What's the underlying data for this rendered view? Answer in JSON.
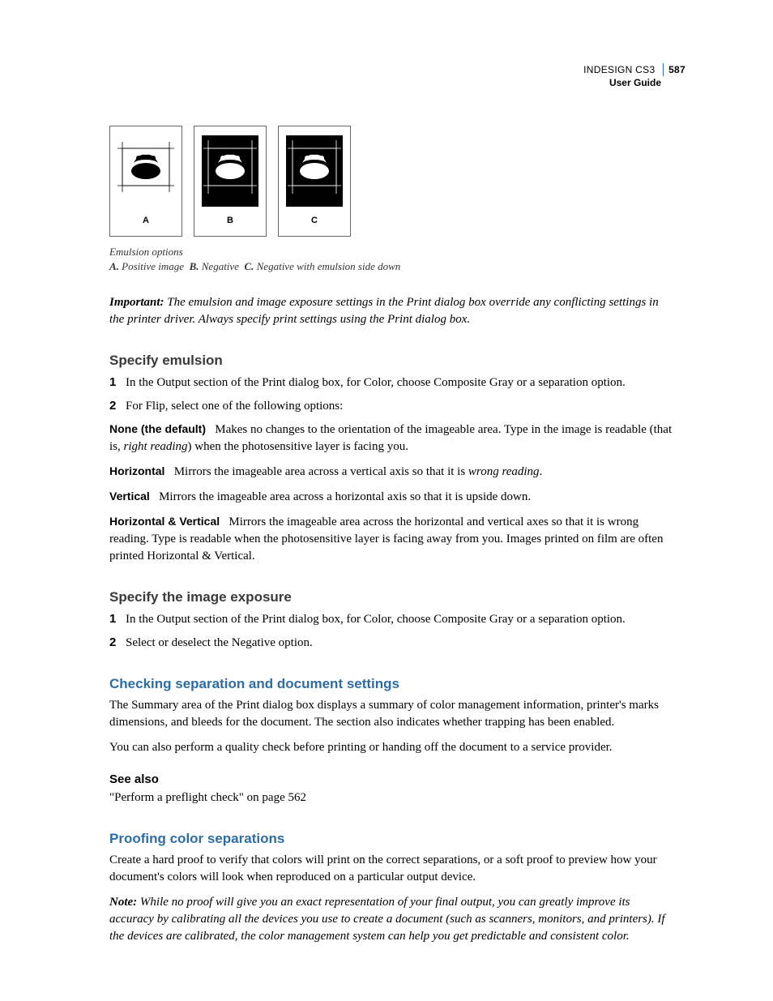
{
  "header": {
    "product": "INDESIGN CS3",
    "doc": "User Guide",
    "page": "587"
  },
  "figure": {
    "labels": {
      "a": "A",
      "b": "B",
      "c": "C"
    },
    "caption_title": "Emulsion options",
    "caption_a_key": "A.",
    "caption_a_val": "Positive image",
    "caption_b_key": "B.",
    "caption_b_val": "Negative",
    "caption_c_key": "C.",
    "caption_c_val": "Negative with emulsion side down"
  },
  "important": {
    "lead": "Important:",
    "body": "The emulsion and image exposure settings in the Print dialog box override any conflicting settings in the printer driver. Always specify print settings using the Print dialog box."
  },
  "sec_emulsion": {
    "title": "Specify emulsion",
    "step1": "In the Output section of the Print dialog box, for Color, choose Composite Gray or a separation option.",
    "step2": "For Flip, select one of the following options:",
    "defs": {
      "none_term": "None (the default)",
      "none_body_a": "Makes no changes to the orientation of the imageable area. Type in the image is readable (that is, ",
      "none_body_ital": "right reading",
      "none_body_b": ") when the photosensitive layer is facing you.",
      "horiz_term": "Horizontal",
      "horiz_body_a": "Mirrors the imageable area across a vertical axis so that it is ",
      "horiz_body_ital": "wrong reading",
      "horiz_body_b": ".",
      "vert_term": "Vertical",
      "vert_body": "Mirrors the imageable area across a horizontal axis so that it is upside down.",
      "hv_term": "Horizontal & Vertical",
      "hv_body": "Mirrors the imageable area across the horizontal and vertical axes so that it is wrong reading. Type is readable when the photosensitive layer is facing away from you. Images printed on film are often printed Horizontal & Vertical."
    }
  },
  "sec_exposure": {
    "title": "Specify the image exposure",
    "step1": "In the Output section of the Print dialog box, for Color, choose Composite Gray or a separation option.",
    "step2": "Select or deselect the Negative option."
  },
  "sec_checking": {
    "title": "Checking separation and document settings",
    "p1": "The Summary area of the Print dialog box displays a summary of color management information, printer's marks dimensions, and bleeds for the document. The section also indicates whether trapping has been enabled.",
    "p2": "You can also perform a quality check before printing or handing off the document to a service provider."
  },
  "see_also": {
    "title": "See also",
    "link": "\"Perform a preflight check\" on page 562"
  },
  "sec_proof": {
    "title": "Proofing color separations",
    "p1": "Create a hard proof to verify that colors will print on the correct separations, or a soft proof to preview how your document's colors will look when reproduced on a particular output device.",
    "note_lead": "Note:",
    "note_body": "While no proof will give you an exact representation of your final output, you can greatly improve its accuracy by calibrating all the devices you use to create a document (such as scanners, monitors, and printers). If the devices are calibrated, the color management system can help you get predictable and consistent color."
  }
}
